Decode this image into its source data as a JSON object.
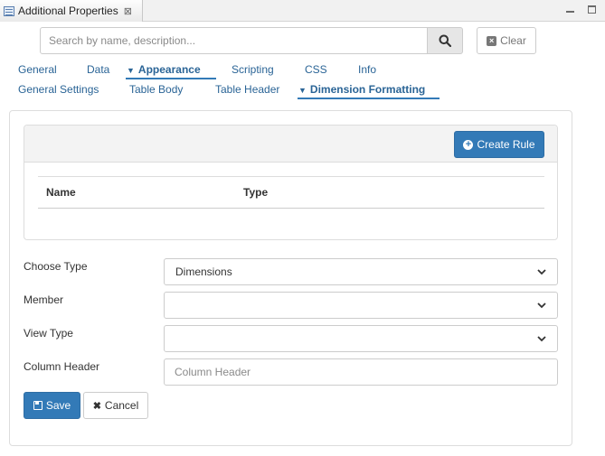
{
  "window": {
    "tab_title": "Additional Properties",
    "close_glyph": "⊠"
  },
  "search": {
    "placeholder": "Search by name, description...",
    "value": "",
    "clear_label": "Clear"
  },
  "tabs_row1": [
    {
      "label": "General",
      "active": false
    },
    {
      "label": "Data",
      "active": false
    },
    {
      "label": "Appearance",
      "active": true,
      "expanded": true
    },
    {
      "label": "Scripting",
      "active": false
    },
    {
      "label": "CSS",
      "active": false
    },
    {
      "label": "Info",
      "active": false
    }
  ],
  "tabs_row2": [
    {
      "label": "General Settings",
      "active": false
    },
    {
      "label": "Table Body",
      "active": false
    },
    {
      "label": "Table Header",
      "active": false
    },
    {
      "label": "Dimension Formatting",
      "active": true,
      "expanded": true
    }
  ],
  "rules": {
    "create_label": "Create Rule",
    "columns": [
      "Name",
      "Type"
    ],
    "rows": []
  },
  "form": {
    "choose_type": {
      "label": "Choose Type",
      "value": "Dimensions"
    },
    "member": {
      "label": "Member",
      "value": ""
    },
    "view_type": {
      "label": "View Type",
      "value": ""
    },
    "column_header": {
      "label": "Column Header",
      "placeholder": "Column Header",
      "value": ""
    }
  },
  "actions": {
    "save_label": "Save",
    "cancel_label": "Cancel"
  },
  "colors": {
    "primary": "#337ab7",
    "link": "#2a6496"
  }
}
